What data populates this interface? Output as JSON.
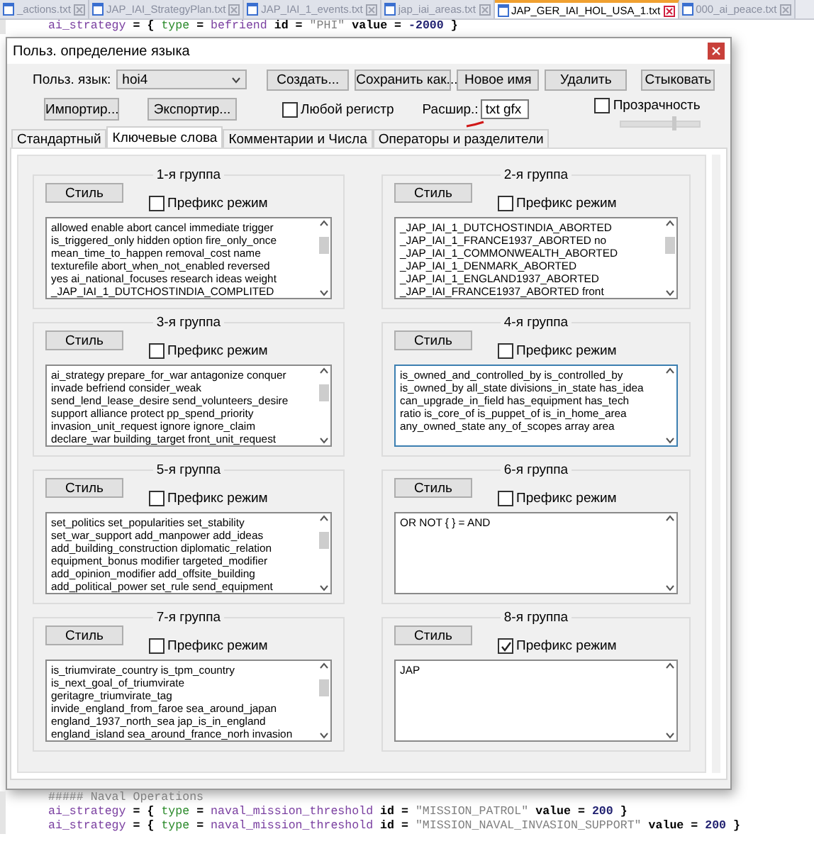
{
  "editor_tabs": [
    {
      "label": "_actions.txt",
      "selected": false
    },
    {
      "label": "JAP_IAI_StrategyPlan.txt",
      "selected": false
    },
    {
      "label": "JAP_IAI_1_events.txt",
      "selected": false
    },
    {
      "label": "jap_iai_areas.txt",
      "selected": false
    },
    {
      "label": "JAP_GER_IAI_HOL_USA_1.txt",
      "selected": true
    },
    {
      "label": "000_ai_peace.txt",
      "selected": false
    }
  ],
  "editor_lines_top": [
    [
      {
        "text": "ai_strategy",
        "kind": "keyword"
      },
      {
        "text": " = { ",
        "kind": "plain"
      },
      {
        "text": "type",
        "kind": "type"
      },
      {
        "text": " = ",
        "kind": "plain"
      },
      {
        "text": "befriend",
        "kind": "keyword"
      },
      {
        "text": " id = ",
        "kind": "plain"
      },
      {
        "text": "\"PHI\"",
        "kind": "string"
      },
      {
        "text": " value = ",
        "kind": "plain"
      },
      {
        "text": "-2000",
        "kind": "number"
      },
      {
        "text": " }",
        "kind": "plain"
      }
    ]
  ],
  "dialog": {
    "title": "Польз. определение языка",
    "language_label": "Польз. язык:",
    "language": "hoi4",
    "buttons_row1": [
      "Создать...",
      "Сохранить как...",
      "Новое имя",
      "Удалить",
      "Стыковать"
    ],
    "buttons_row2": [
      "Импортир...",
      "Экспортир..."
    ],
    "ignore_case": {
      "label": "Любой регистр",
      "checked": false
    },
    "extension_label": "Расшир.:",
    "extension": "txt gfx",
    "transparency": {
      "label": "Прозрачность",
      "checked": false,
      "level": 0.65
    },
    "tabs": [
      {
        "label": "Стандартный",
        "selected": false
      },
      {
        "label": "Ключевые слова",
        "selected": true
      },
      {
        "label": "Комментарии и Числа",
        "selected": false
      },
      {
        "label": "Операторы и разделители",
        "selected": false
      }
    ],
    "groups": [
      {
        "title": "1-я группа",
        "style_button": "Стиль",
        "prefix_mode": {
          "label": "Префикс режим",
          "checked": false
        },
        "focused": false,
        "keywords": [
          "allowed enable abort cancel immediate trigger",
          "is_triggered_only hidden option fire_only_once",
          "mean_time_to_happen removal_cost name",
          "texturefile abort_when_not_enabled reversed",
          "yes ai_national_focuses research ideas weight",
          "_JAP_IAI_1_DUTCHOSTINDIA_COMPLITED"
        ]
      },
      {
        "title": "2-я группа",
        "style_button": "Стиль",
        "prefix_mode": {
          "label": "Префикс режим",
          "checked": false
        },
        "focused": false,
        "keywords": [
          "_JAP_IAI_1_DUTCHOSTINDIA_ABORTED",
          "_JAP_IAI_1_FRANCE1937_ABORTED no",
          "_JAP_IAI_1_COMMONWEALTH_ABORTED",
          "_JAP_IAI_1_DENMARK_ABORTED",
          "_JAP_IAI_1_ENGLAND1937_ABORTED",
          "_JAP_IAI_FRANCE1937_ABORTED front"
        ]
      },
      {
        "title": "3-я группа",
        "style_button": "Стиль",
        "prefix_mode": {
          "label": "Префикс режим",
          "checked": false
        },
        "focused": false,
        "keywords": [
          "ai_strategy prepare_for_war antagonize conquer",
          "invade befriend consider_weak",
          "send_lend_lease_desire send_volunteers_desire",
          "support alliance protect pp_spend_priority",
          "invasion_unit_request ignore ignore_claim",
          "declare_war building_target front_unit_request"
        ]
      },
      {
        "title": "4-я группа",
        "style_button": "Стиль",
        "prefix_mode": {
          "label": "Префикс режим",
          "checked": false
        },
        "focused": true,
        "keywords": [
          "is_owned_and_controlled_by is_controlled_by",
          "is_owned_by all_state divisions_in_state has_idea",
          "can_upgrade_in_field has_equipment has_tech",
          "ratio is_core_of is_puppet_of is_in_home_area",
          "any_owned_state any_of_scopes array area"
        ]
      },
      {
        "title": "5-я группа",
        "style_button": "Стиль",
        "prefix_mode": {
          "label": "Префикс режим",
          "checked": false
        },
        "focused": false,
        "keywords": [
          "set_politics set_popularities set_stability",
          "set_war_support add_manpower add_ideas",
          "add_building_construction diplomatic_relation",
          "equipment_bonus modifier targeted_modifier",
          "add_opinion_modifier add_offsite_building",
          "add_political_power set_rule send_equipment"
        ]
      },
      {
        "title": "6-я группа",
        "style_button": "Стиль",
        "prefix_mode": {
          "label": "Префикс режим",
          "checked": false
        },
        "focused": false,
        "keywords": [
          "OR NOT { } = AND"
        ]
      },
      {
        "title": "7-я группа",
        "style_button": "Стиль",
        "prefix_mode": {
          "label": "Префикс режим",
          "checked": false
        },
        "focused": false,
        "keywords": [
          "is_triumvirate_country is_tpm_country",
          "is_next_goal_of_triumvirate",
          "geritagre_triumvirate_tag",
          "invide_england_from_faroe sea_around_japan",
          "england_1937_north_sea jap_is_in_england",
          "england_island sea_around_france_norh invasion"
        ]
      },
      {
        "title": "8-я группа",
        "style_button": "Стиль",
        "prefix_mode": {
          "label": "Префикс режим",
          "checked": true
        },
        "focused": false,
        "keywords": [
          "JAP"
        ]
      }
    ]
  },
  "editor_lines_bottom": [
    [
      {
        "text": "##### Naval Operations",
        "kind": "comment"
      }
    ],
    [
      {
        "text": "ai_strategy",
        "kind": "keyword"
      },
      {
        "text": " = { ",
        "kind": "plain"
      },
      {
        "text": "type",
        "kind": "type"
      },
      {
        "text": " = ",
        "kind": "plain"
      },
      {
        "text": "naval_mission_threshold",
        "kind": "keyword"
      },
      {
        "text": " id = ",
        "kind": "plain"
      },
      {
        "text": "\"MISSION_PATROL\"",
        "kind": "string"
      },
      {
        "text": " value = ",
        "kind": "plain"
      },
      {
        "text": "200",
        "kind": "number"
      },
      {
        "text": " }",
        "kind": "plain"
      }
    ],
    [
      {
        "text": "ai_strategy",
        "kind": "keyword"
      },
      {
        "text": " = { ",
        "kind": "plain"
      },
      {
        "text": "type",
        "kind": "type"
      },
      {
        "text": " = ",
        "kind": "plain"
      },
      {
        "text": "naval_mission_threshold",
        "kind": "keyword"
      },
      {
        "text": " id = ",
        "kind": "plain"
      },
      {
        "text": "\"MISSION_NAVAL_INVASION_SUPPORT\"",
        "kind": "string"
      },
      {
        "text": " value = ",
        "kind": "plain"
      },
      {
        "text": "200",
        "kind": "number"
      },
      {
        "text": " }",
        "kind": "plain"
      }
    ]
  ]
}
